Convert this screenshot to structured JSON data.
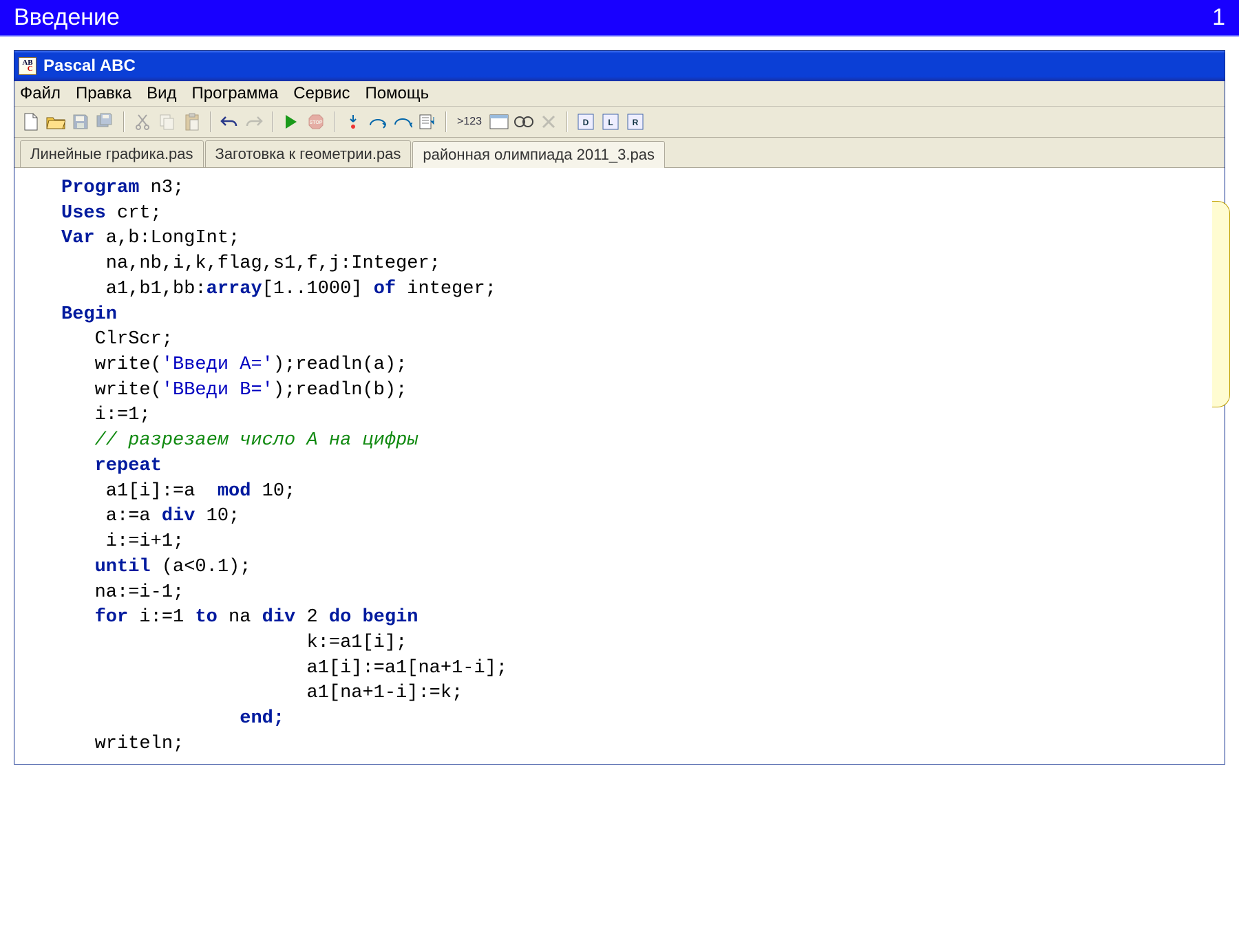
{
  "slide": {
    "title": "Введение",
    "page": "1"
  },
  "window": {
    "title": "Pascal ABC"
  },
  "menu": {
    "file": "Файл",
    "edit": "Правка",
    "view": "Вид",
    "program": "Программа",
    "service": "Сервис",
    "help": "Помощь"
  },
  "tabs": {
    "t1": "Линейные графика.pas",
    "t2": "Заготовка к геометрии.pas",
    "t3": "районная олимпиада 2011_3.pas"
  },
  "toolbar": {
    "vars_label": ">123"
  },
  "code": {
    "l1a": "Program",
    "l1b": " n3;",
    "l2a": "Uses",
    "l2b": " crt;",
    "l3a": "Var",
    "l3b": " a,b:LongInt;",
    "l4": "    na,nb,i,k,flag,s1,f,j:Integer;",
    "l5a": "    a1,b1,bb:",
    "l5b": "array",
    "l5c": "[1..1000] ",
    "l5d": "of",
    "l5e": " integer;",
    "l6": "Begin",
    "l7": "   ClrScr;",
    "l8a": "   write(",
    "l8b": "'Введи A='",
    "l8c": ");readln(a);",
    "l9a": "   write(",
    "l9b": "'ВВеди B='",
    "l9c": ");readln(b);",
    "l10": "   i:=1;",
    "l11": "   // разрезаем число A на цифры",
    "l12": "   repeat",
    "l13a": "    a1[i]:=a  ",
    "l13b": "mod",
    "l13c": " 10;",
    "l14a": "    a:=a ",
    "l14b": "div",
    "l14c": " 10;",
    "l15": "    i:=i+1;",
    "l16a": "   until",
    "l16b": " (a<0.1);",
    "l17": "   na:=i-1;",
    "l18a": "   for",
    "l18b": " i:=1 ",
    "l18c": "to",
    "l18d": " na ",
    "l18e": "div",
    "l18f": " 2 ",
    "l18g": "do begin",
    "l19": "                      k:=a1[i];",
    "l20": "                      a1[i]:=a1[na+1-i];",
    "l21": "                      a1[na+1-i]:=k;",
    "l22": "                end;",
    "l23": "   writeln;"
  }
}
